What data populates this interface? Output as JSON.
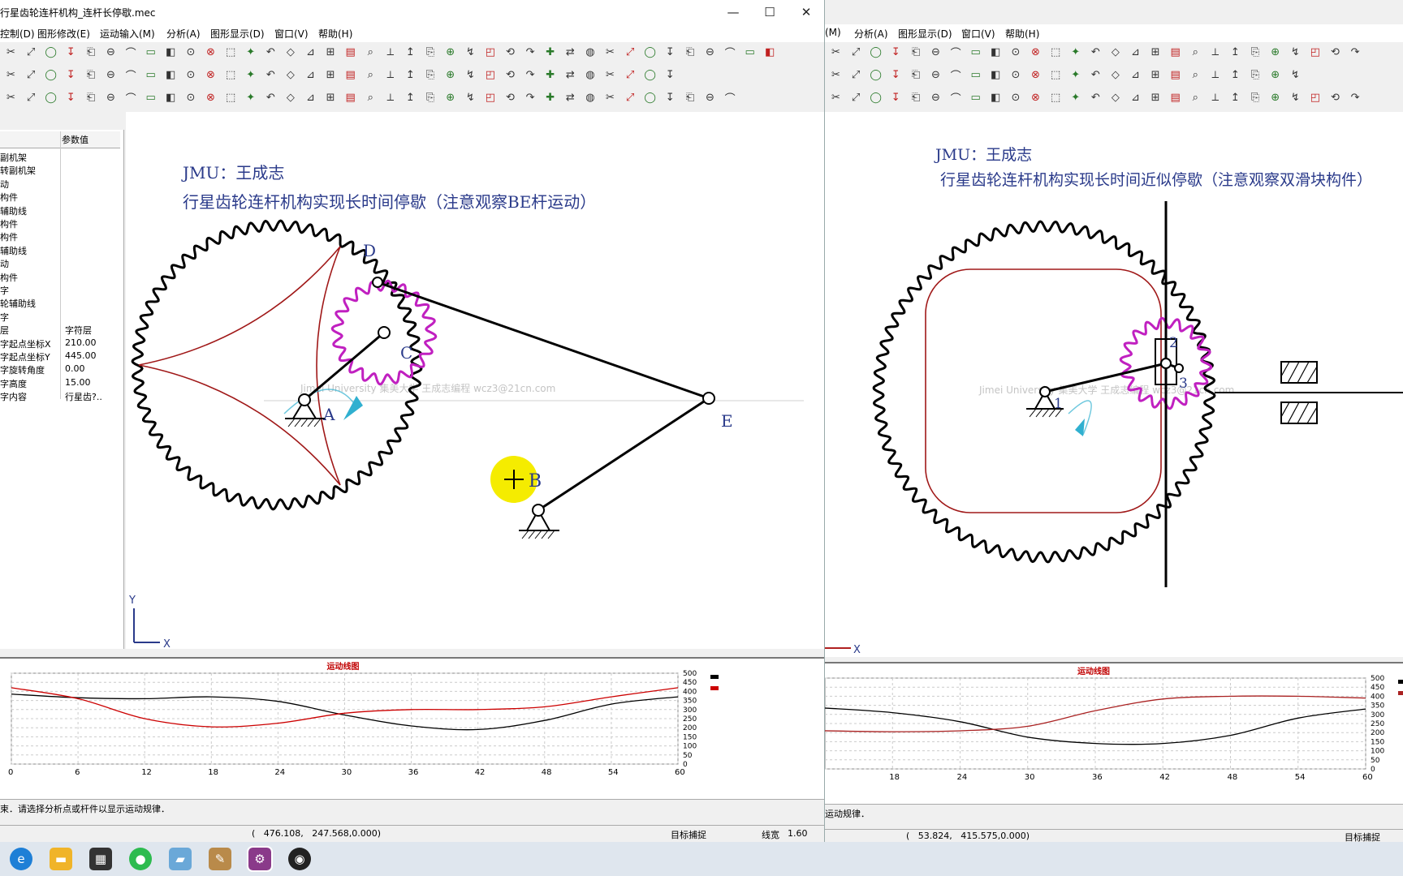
{
  "left_window": {
    "title": "行星齿轮连杆机构_连杆长停歇.mec",
    "menus": [
      "控制(D)",
      "图形修改(E)",
      "运动输入(M)",
      "分析(A)",
      "图形显示(D)",
      "窗口(V)",
      "帮助(H)"
    ],
    "props_header": "参数值",
    "props": [
      {
        "name": "副机架",
        "value": ""
      },
      {
        "name": "转副机架",
        "value": ""
      },
      {
        "name": "动",
        "value": ""
      },
      {
        "name": "构件",
        "value": ""
      },
      {
        "name": "辅助线",
        "value": ""
      },
      {
        "name": "构件",
        "value": ""
      },
      {
        "name": "构件",
        "value": ""
      },
      {
        "name": "辅助线",
        "value": ""
      },
      {
        "name": "动",
        "value": ""
      },
      {
        "name": "构件",
        "value": ""
      },
      {
        "name": "字",
        "value": ""
      },
      {
        "name": "轮辅助线",
        "value": ""
      },
      {
        "name": "字",
        "value": ""
      },
      {
        "name": "层",
        "value": "字符层"
      },
      {
        "name": "字起点坐标X",
        "value": "210.00"
      },
      {
        "name": "字起点坐标Y",
        "value": "445.00"
      },
      {
        "name": "字旋转角度",
        "value": "0.00"
      },
      {
        "name": "字高度",
        "value": "15.00"
      },
      {
        "name": "字内容",
        "value": "行星齿?.."
      }
    ],
    "author": "JMU：王成志",
    "caption": "行星齿轮连杆机构实现长时间停歇（注意观察BE杆运动）",
    "watermark": "Jimei University 集美大学 王成志编程  wcz3@21cn.com",
    "labels": {
      "A": "A",
      "B": "B",
      "C": "C",
      "D": "D",
      "E": "E"
    },
    "axis_y": "Y",
    "axis_x": "X",
    "status_text": "束．请选择分析点或杆件以显示运动规律．",
    "coords": "(   476.108,   247.568,0.000)",
    "snap": "目标捕捉",
    "linewidth_label": "线宽",
    "linewidth_value": "1.60"
  },
  "right_window": {
    "menus": [
      "(M)",
      "分析(A)",
      "图形显示(D)",
      "窗口(V)",
      "帮助(H)"
    ],
    "author": "JMU：王成志",
    "caption": "行星齿轮连杆机构实现长时间近似停歇（注意观察双滑块构件）",
    "watermark": "Jimei University 集美大学 王成志编程  wcz3@21cn.com",
    "labels": {
      "p1": "1",
      "p2": "2",
      "p3": "3"
    },
    "axis_x": "X",
    "status_text": "运动规律．",
    "coords": "(   53.824,   415.575,0.000)",
    "snap": "目标捕捉"
  },
  "chart_data": [
    {
      "type": "line",
      "title": "运动线图",
      "xlim": [
        0,
        60
      ],
      "x_ticks": [
        0,
        6,
        12,
        18,
        24,
        30,
        36,
        42,
        48,
        54,
        60
      ],
      "ylim": [
        0,
        500
      ],
      "y_ticks": [
        0,
        50,
        100,
        150,
        200,
        250,
        300,
        350,
        400,
        450,
        500
      ],
      "grid": true,
      "legend": "right",
      "series": [
        {
          "color": "#000000",
          "x": [
            0,
            6,
            12,
            18,
            24,
            30,
            36,
            42,
            48,
            54,
            60
          ],
          "values": [
            385,
            365,
            360,
            370,
            345,
            270,
            210,
            190,
            240,
            330,
            370
          ]
        },
        {
          "color": "#cc0000",
          "x": [
            0,
            6,
            12,
            18,
            24,
            30,
            36,
            42,
            48,
            54,
            60
          ],
          "values": [
            420,
            360,
            250,
            205,
            225,
            280,
            300,
            300,
            315,
            370,
            420
          ]
        }
      ]
    },
    {
      "type": "line",
      "title": "运动线图",
      "xlim": [
        12,
        60
      ],
      "x_ticks": [
        18,
        24,
        30,
        36,
        42,
        48,
        54,
        60
      ],
      "ylim": [
        0,
        500
      ],
      "y_ticks": [
        0,
        50,
        100,
        150,
        200,
        250,
        300,
        350,
        400,
        450,
        500
      ],
      "grid": true,
      "legend": "right",
      "series": [
        {
          "color": "#000000",
          "x": [
            12,
            18,
            24,
            30,
            36,
            42,
            48,
            54,
            60
          ],
          "values": [
            335,
            310,
            260,
            175,
            140,
            140,
            185,
            280,
            330
          ]
        },
        {
          "color": "#aa2222",
          "x": [
            12,
            18,
            24,
            30,
            36,
            42,
            48,
            54,
            60
          ],
          "values": [
            210,
            205,
            210,
            235,
            320,
            385,
            400,
            400,
            390
          ]
        }
      ]
    }
  ],
  "taskbar": [
    "edge-icon",
    "explorer-icon",
    "store-icon",
    "wechat-icon",
    "app-icon",
    "paint-icon",
    "mec-icon",
    "media-icon"
  ]
}
